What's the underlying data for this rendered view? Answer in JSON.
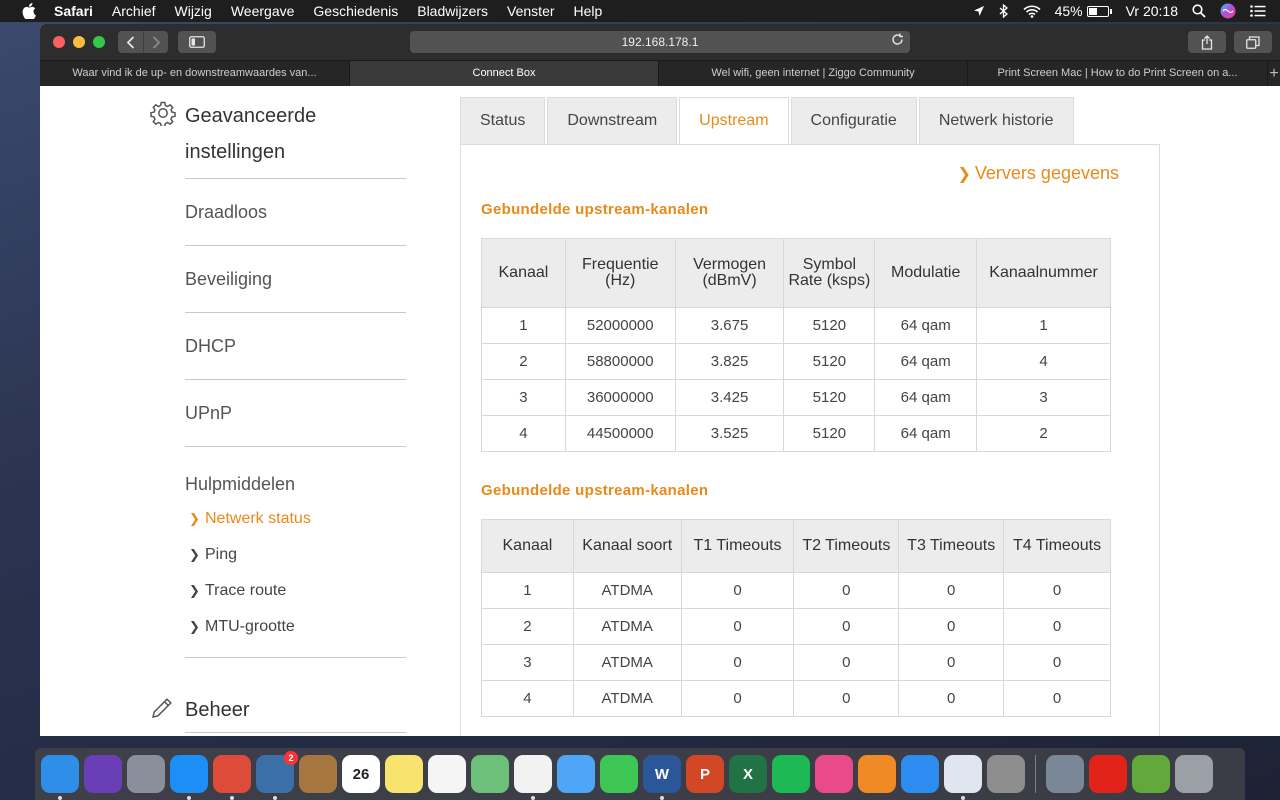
{
  "menubar": {
    "app_name": "Safari",
    "items": [
      "Archief",
      "Wijzig",
      "Weergave",
      "Geschiedenis",
      "Bladwijzers",
      "Venster",
      "Help"
    ],
    "battery_percent_label": "45%",
    "battery_level": 0.45,
    "clock": "Vr 20:18"
  },
  "browser": {
    "url": "192.168.178.1",
    "tabs": [
      "Waar vind ik de up- en downstreamwaardes van...",
      "Connect Box",
      "Wel wifi, geen internet | Ziggo Community",
      "Print Screen Mac | How to do Print Screen on a..."
    ],
    "active_tab_index": 1,
    "new_tab_glyph": "+"
  },
  "sidebar": {
    "title": "Geavanceerde instellingen",
    "links": [
      "Draadloos",
      "Beveiliging",
      "DHCP",
      "UPnP"
    ],
    "tools_title": "Hulpmiddelen",
    "tools": [
      "Netwerk status",
      "Ping",
      "Trace route",
      "MTU-grootte"
    ],
    "active_tool_index": 0,
    "beheer_title": "Beheer"
  },
  "tabs": [
    "Status",
    "Downstream",
    "Upstream",
    "Configuratie",
    "Netwerk historie"
  ],
  "active_tab": "Upstream",
  "refresh_label": "Ververs gegevens",
  "table1": {
    "caption": "Gebundelde upstream-kanalen",
    "headers": [
      "Kanaal",
      "Frequentie (Hz)",
      "Vermogen (dBmV)",
      "Symbol Rate (ksps)",
      "Modulatie",
      "Kanaalnummer"
    ],
    "rows": [
      [
        "1",
        "52000000",
        "3.675",
        "5120",
        "64 qam",
        "1"
      ],
      [
        "2",
        "58800000",
        "3.825",
        "5120",
        "64 qam",
        "4"
      ],
      [
        "3",
        "36000000",
        "3.425",
        "5120",
        "64 qam",
        "3"
      ],
      [
        "4",
        "44500000",
        "3.525",
        "5120",
        "64 qam",
        "2"
      ]
    ]
  },
  "table2": {
    "caption": "Gebundelde upstream-kanalen",
    "headers": [
      "Kanaal",
      "Kanaal soort",
      "T1 Timeouts",
      "T2 Timeouts",
      "T3 Timeouts",
      "T4 Timeouts"
    ],
    "rows": [
      [
        "1",
        "ATDMA",
        "0",
        "0",
        "0",
        "0"
      ],
      [
        "2",
        "ATDMA",
        "0",
        "0",
        "0",
        "0"
      ],
      [
        "3",
        "ATDMA",
        "0",
        "0",
        "0",
        "0"
      ],
      [
        "4",
        "ATDMA",
        "0",
        "0",
        "0",
        "0"
      ]
    ]
  },
  "colors": {
    "accent": "#e88a1a",
    "menubar": "#1e1e1f",
    "toolbar": "#2d2d2e"
  },
  "dock": {
    "apps": [
      {
        "name": "finder-icon",
        "color": "#2f8fe8",
        "running": true
      },
      {
        "name": "siri-icon",
        "color": "#6a3fb5",
        "running": false
      },
      {
        "name": "launchpad-icon",
        "color": "#8a8f99",
        "running": false
      },
      {
        "name": "safari-icon",
        "color": "#1c8ef5",
        "running": true
      },
      {
        "name": "chrome-icon",
        "color": "#dd4b39",
        "running": true
      },
      {
        "name": "preview-icon",
        "color": "#3a6fa8",
        "running": true,
        "badge": "2"
      },
      {
        "name": "contacts-icon",
        "color": "#a5763f",
        "running": false
      },
      {
        "name": "calendar-icon",
        "color": "#ffffff",
        "running": false,
        "text": "26"
      },
      {
        "name": "notes-icon",
        "color": "#f8e36e",
        "running": false
      },
      {
        "name": "reminders-icon",
        "color": "#f5f5f5",
        "running": false
      },
      {
        "name": "maps-icon",
        "color": "#6dc07a",
        "running": false
      },
      {
        "name": "photos-icon",
        "color": "#f2f2f2",
        "running": true
      },
      {
        "name": "messages-icon",
        "color": "#4ea6f7",
        "running": false
      },
      {
        "name": "facetime-icon",
        "color": "#3dc654",
        "running": false
      },
      {
        "name": "word-icon",
        "color": "#2b579a",
        "running": true,
        "text": "W"
      },
      {
        "name": "powerpoint-icon",
        "color": "#d24726",
        "running": false,
        "text": "P"
      },
      {
        "name": "excel-icon",
        "color": "#217346",
        "running": false,
        "text": "X"
      },
      {
        "name": "spotify-icon",
        "color": "#1db954",
        "running": false
      },
      {
        "name": "itunes-icon",
        "color": "#e94b8a",
        "running": false
      },
      {
        "name": "ibooks-icon",
        "color": "#f08a24",
        "running": false
      },
      {
        "name": "appstore-icon",
        "color": "#2d8cf0",
        "running": false
      },
      {
        "name": "preview-docs-icon",
        "color": "#dfe6ef",
        "running": true
      },
      {
        "name": "system-preferences-icon",
        "color": "#8d8d8d",
        "running": false
      }
    ],
    "right_apps": [
      {
        "name": "image-capture-icon",
        "color": "#7a8796"
      },
      {
        "name": "acrobat-icon",
        "color": "#e2231a"
      },
      {
        "name": "turtle-icon",
        "color": "#63a83a"
      },
      {
        "name": "trash-icon",
        "color": "#9aa0a6"
      }
    ]
  }
}
